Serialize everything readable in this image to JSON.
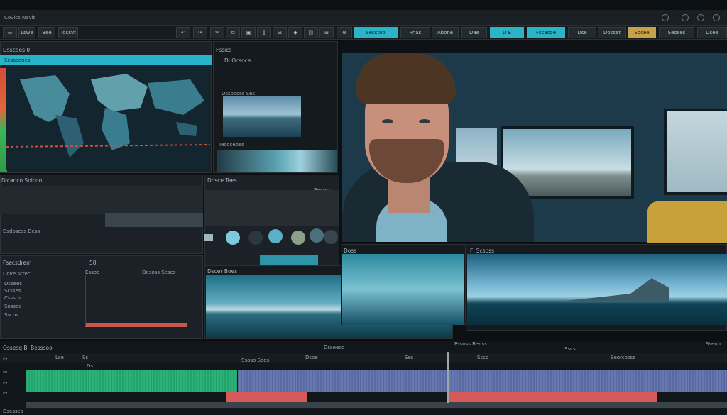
{
  "app": {
    "title": "Covics Navit"
  },
  "toolbar": {
    "buttons": [
      "Lswe",
      "Bee",
      "Tocsvt",
      "Sesstoo",
      "Pnas",
      "Abone",
      "Dae",
      "D E",
      "Fssacoe",
      "Dse",
      "Dosset",
      "Socee",
      "Seoses",
      "Dsee"
    ]
  },
  "left_panel": {
    "title": "Dsscdes 0",
    "tab": "Sesscones",
    "lower_title": "Dicanco Soicoo",
    "lower_caption": "Dsdosess Dess",
    "props_title": "Fsecsdrem",
    "props_value": "58",
    "props_label": "Dove screc",
    "props_mid": "Essoc",
    "props_right": "Oesoss Sescs",
    "props_list": [
      "Dsseec",
      "Scsses",
      "Csssos",
      "Sossoe",
      "Sscos"
    ]
  },
  "mid_panel": {
    "header": "Fssics",
    "sub": "Dl Ocsoce",
    "clip1_label": "Dssocoss Ses",
    "clip2_label": "Tecoceoes",
    "library_title": "Dosce Tees",
    "library_meta": "Besoss"
  },
  "preview_small": {
    "title": "Dscer Boes"
  },
  "preview_right": {
    "title": "Fl Scsoss",
    "label_left": "Doss"
  },
  "timeline": {
    "title": "Ossesq Bl Besssoo",
    "center_label": "Dsseeco",
    "right_label": "Fssoss Beoss",
    "far_right": "Sscs",
    "end_label": "Sseoo",
    "markers": [
      "Lse",
      "Ss",
      "Ds",
      "Ssoso Soos",
      "Dsoe",
      "Ses",
      "Ssco",
      "Seorcosse"
    ],
    "time": "Dsessco"
  },
  "colors": {
    "accent": "#27b4c8",
    "gold": "#c8a24a",
    "green": "#2cb27a",
    "purple": "#6878b0",
    "red": "#d65a5a"
  }
}
